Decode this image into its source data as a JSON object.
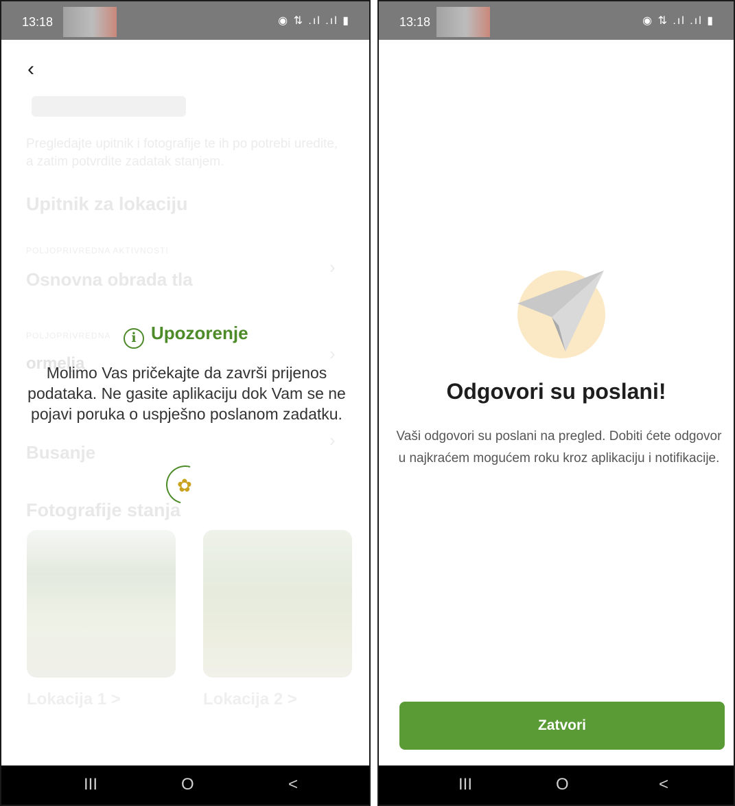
{
  "left_screen": {
    "status_bar": {
      "time": "13:18",
      "icons": "◉ ⇅ .ıl .ıl ▮"
    },
    "back_icon": "chevron-left-icon",
    "background": {
      "description_text": "Pregledajte upitnik i fotografije te ih po potrebi uredite, a zatim potvrdite zadatak stanjem.",
      "questionnaire_heading": "Upitnik za lokaciju",
      "items": [
        {
          "category": "POLJOPRIVREDNA AKTIVNOSTI",
          "title": "Osnovna obrada tla"
        },
        {
          "category": "POLJOPRIVREDNA",
          "title": "ormelja"
        },
        {
          "category": "",
          "title": "Busanje"
        }
      ],
      "photos_heading": "Fotografije stanja",
      "photos": [
        {
          "label": "Lokacija 1 >"
        },
        {
          "label": "Lokacija 2 >"
        }
      ]
    },
    "warning": {
      "title": "Upozorenje",
      "message": "Molimo Vas pričekajte da završi prijenos podataka. Ne gasite aplikaciju dok Vam se ne pojavi poruka o uspješno poslanom zadatku."
    },
    "nav_bar": {
      "recents": "III",
      "home": "O",
      "back": "<"
    }
  },
  "right_screen": {
    "status_bar": {
      "time": "13:18",
      "icons": "◉ ⇅ .ıl .ıl ▮"
    },
    "illustration": "paper-plane-icon",
    "title": "Odgovori su poslani!",
    "message": "Vaši odgovori su poslani na pregled. Dobiti ćete odgovor u najkraćem mogućem roku kroz aplikaciju i notifikacije.",
    "close_button": "Zatvori",
    "nav_bar": {
      "recents": "III",
      "home": "O",
      "back": "<"
    }
  },
  "colors": {
    "accent_green": "#5a9b36",
    "warning_green": "#4d8a28",
    "plane_circle": "#fbe8c4"
  }
}
